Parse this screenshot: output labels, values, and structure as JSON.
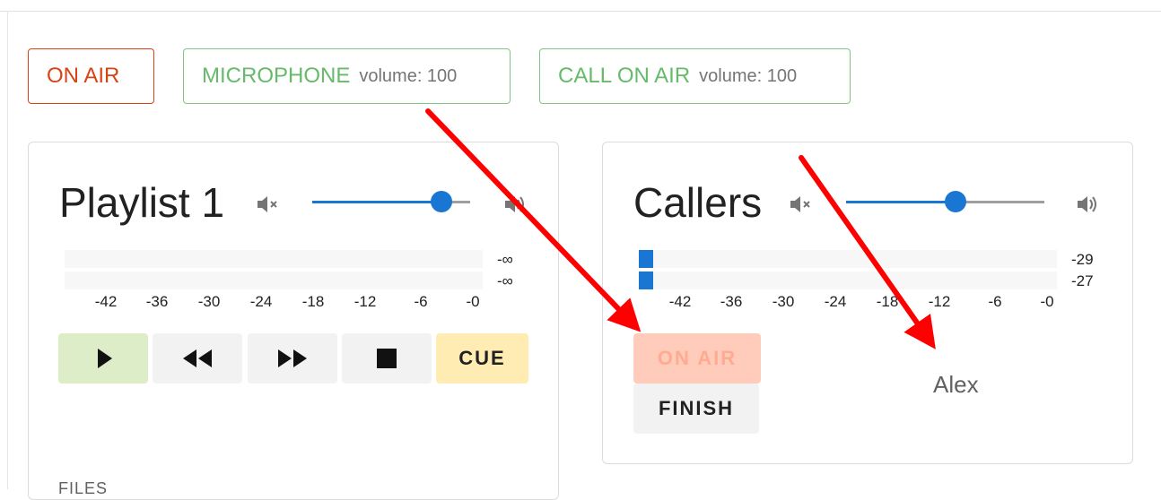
{
  "status_bar": {
    "on_air": "ON AIR",
    "microphone": {
      "label": "MICROPHONE",
      "volume": "volume: 100"
    },
    "call_on_air": {
      "label": "CALL ON AIR",
      "volume": "volume: 100"
    }
  },
  "playlist": {
    "title": "Playlist 1",
    "volume_level": 0.82,
    "meter": {
      "values": [
        "-∞",
        "-∞"
      ],
      "levels": [
        0,
        0
      ]
    },
    "scale": [
      "-42",
      "-36",
      "-30",
      "-24",
      "-18",
      "-12",
      "-6",
      "-0"
    ],
    "controls": {
      "cue": "CUE"
    },
    "files_label": "FILES"
  },
  "callers": {
    "title": "Callers",
    "volume_level": 0.55,
    "meter": {
      "values": [
        "-29",
        "-27"
      ],
      "levels": [
        0.035,
        0.035
      ]
    },
    "scale": [
      "-42",
      "-36",
      "-30",
      "-24",
      "-18",
      "-12",
      "-6",
      "-0"
    ],
    "on_air_button": "ON AIR",
    "finish_button": "FINISH",
    "caller_name": "Alex"
  },
  "colors": {
    "accent": "#1976d2",
    "on_air": "#d84315",
    "green": "#66bb6a",
    "annotation_arrow": "#ff0000"
  },
  "icons": [
    "mute-icon",
    "volume-icon",
    "play-icon",
    "rewind-icon",
    "fast-forward-icon",
    "stop-icon"
  ]
}
